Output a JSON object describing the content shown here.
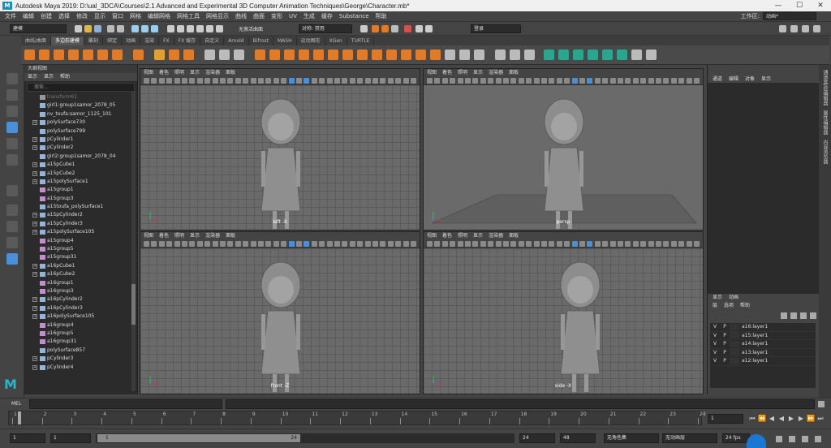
{
  "window": {
    "title": "Autodesk Maya 2019: D:\\ual_3DCA\\Courses\\2.1 Advanced and Experimental 3D Computer Animation Techniques\\George\\Character.mb*",
    "logo": "M"
  },
  "menubar": {
    "items": [
      "文件",
      "编辑",
      "创建",
      "选择",
      "修改",
      "显示",
      "窗口",
      "网格",
      "编辑网格",
      "网格工具",
      "网格显示",
      "曲线",
      "曲面",
      "变形",
      "UV",
      "生成",
      "缓存",
      "Substance",
      "帮助"
    ],
    "workspace_label": "工作区:",
    "workspace_value": "动画*"
  },
  "statusline": {
    "mode_value": "建模",
    "symmetry_label": "无激活曲面",
    "symmetry_dd": "对称: 禁用",
    "login_label": "登录"
  },
  "shelf": {
    "tabs": [
      "曲线/曲面",
      "多边形建模",
      "雕刻",
      "绑定",
      "动画",
      "渲染",
      "FX",
      "FX 缓存",
      "自定义",
      "Arnold",
      "Bifrost",
      "MASH",
      "运动图形",
      "XGen",
      "TURTLE"
    ],
    "active_tab": "多边形建模"
  },
  "outliner": {
    "title": "大纲视图",
    "menu": [
      "显示",
      "显示",
      "帮助"
    ],
    "search_placeholder": "搜索...",
    "items": [
      {
        "label": "transform61",
        "expandable": false,
        "icon": "transform-icon",
        "dim": true
      },
      {
        "label": "girl1:group1samor_2078_05",
        "expandable": false,
        "icon": "mesh-icon"
      },
      {
        "label": "nv_toufa:samor_1125_101",
        "expandable": false,
        "icon": "mesh-icon"
      },
      {
        "label": "polySurface730",
        "expandable": true,
        "icon": "mesh-icon"
      },
      {
        "label": "polySurface799",
        "expandable": false,
        "icon": "mesh-icon"
      },
      {
        "label": "pCylinder1",
        "expandable": true,
        "icon": "mesh-icon"
      },
      {
        "label": "pCylinder2",
        "expandable": true,
        "icon": "mesh-icon"
      },
      {
        "label": "girl2:group1samor_2078_04",
        "expandable": false,
        "icon": "mesh-icon"
      },
      {
        "label": "a15pCube1",
        "expandable": true,
        "icon": "mesh-icon"
      },
      {
        "label": "a15pCube2",
        "expandable": true,
        "icon": "mesh-icon"
      },
      {
        "label": "a15polySurface1",
        "expandable": true,
        "icon": "mesh-icon"
      },
      {
        "label": "a15group1",
        "expandable": false,
        "icon": "group-icon"
      },
      {
        "label": "a15group3",
        "expandable": false,
        "icon": "group-icon"
      },
      {
        "label": "a15toufa_polySurface1",
        "expandable": false,
        "icon": "mesh-icon"
      },
      {
        "label": "a15pCylinder2",
        "expandable": true,
        "icon": "mesh-icon"
      },
      {
        "label": "a15pCylinder3",
        "expandable": true,
        "icon": "mesh-icon"
      },
      {
        "label": "a15polySurface105",
        "expandable": true,
        "icon": "mesh-icon"
      },
      {
        "label": "a15group4",
        "expandable": false,
        "icon": "group-icon"
      },
      {
        "label": "a15group5",
        "expandable": false,
        "icon": "group-icon"
      },
      {
        "label": "a15group31",
        "expandable": false,
        "icon": "group-icon"
      },
      {
        "label": "a16pCube1",
        "expandable": true,
        "icon": "mesh-icon"
      },
      {
        "label": "a16pCube2",
        "expandable": true,
        "icon": "mesh-icon"
      },
      {
        "label": "a16group1",
        "expandable": false,
        "icon": "group-icon"
      },
      {
        "label": "a16group3",
        "expandable": false,
        "icon": "group-icon"
      },
      {
        "label": "a16pCylinder2",
        "expandable": true,
        "icon": "mesh-icon"
      },
      {
        "label": "a16pCylinder3",
        "expandable": true,
        "icon": "mesh-icon"
      },
      {
        "label": "a16polySurface105",
        "expandable": true,
        "icon": "mesh-icon"
      },
      {
        "label": "a16group4",
        "expandable": false,
        "icon": "group-icon"
      },
      {
        "label": "a16group5",
        "expandable": false,
        "icon": "group-icon"
      },
      {
        "label": "a16group31",
        "expandable": false,
        "icon": "group-icon"
      },
      {
        "label": "polySurface857",
        "expandable": false,
        "icon": "mesh-icon"
      },
      {
        "label": "pCylinder3",
        "expandable": true,
        "icon": "mesh-icon"
      },
      {
        "label": "pCylinder4",
        "expandable": true,
        "icon": "mesh-icon"
      }
    ]
  },
  "viewports": [
    {
      "menu": [
        "视图",
        "着色",
        "照明",
        "显示",
        "渲染器",
        "面板"
      ],
      "camera": "left -X"
    },
    {
      "menu": [
        "视图",
        "着色",
        "照明",
        "显示",
        "渲染器",
        "面板"
      ],
      "camera": "persp"
    },
    {
      "menu": [
        "视图",
        "着色",
        "照明",
        "显示",
        "渲染器",
        "面板"
      ],
      "camera": "front -Z"
    },
    {
      "menu": [
        "视图",
        "着色",
        "照明",
        "显示",
        "渲染器",
        "面板"
      ],
      "camera": "side -X"
    }
  ],
  "channelbox": {
    "menu": [
      "通道",
      "编辑",
      "对象",
      "显示"
    ]
  },
  "rightstrip": {
    "tabs": [
      "通道盒/层编辑器",
      "属性编辑器",
      "内容浏览器"
    ]
  },
  "layereditor": {
    "tabs": [
      "显示",
      "动画"
    ],
    "menu": [
      "层",
      "选项",
      "帮助"
    ],
    "layers": [
      {
        "v": "V",
        "p": "P",
        "name": "a16:layer1"
      },
      {
        "v": "V",
        "p": "P",
        "name": "a15:layer1"
      },
      {
        "v": "V",
        "p": "P",
        "name": "a14:layer1"
      },
      {
        "v": "V",
        "p": "P",
        "name": "a13:layer1"
      },
      {
        "v": "V",
        "p": "P",
        "name": "a12:layer1"
      }
    ]
  },
  "mel": {
    "label": "MEL"
  },
  "timeslider": {
    "ticks": [
      "1",
      "2",
      "3",
      "4",
      "5",
      "6",
      "7",
      "8",
      "9",
      "10",
      "11",
      "12",
      "13",
      "14",
      "15",
      "16",
      "17",
      "18",
      "19",
      "20",
      "21",
      "22",
      "23",
      "24"
    ],
    "current_frame": "1"
  },
  "rangebar": {
    "start": "1",
    "start2": "1",
    "range_start_label": "1",
    "range_end_label": "24",
    "end": "24",
    "end2": "48",
    "char_set": "无角色集",
    "anim_layer": "无动画层",
    "fps": "24 fps"
  },
  "colors": {
    "accent": "#1b8fb5",
    "shelf_orange": "#e07b2a",
    "shelf_teal": "#2aa58e",
    "maya_logo": "#26b6c8"
  }
}
